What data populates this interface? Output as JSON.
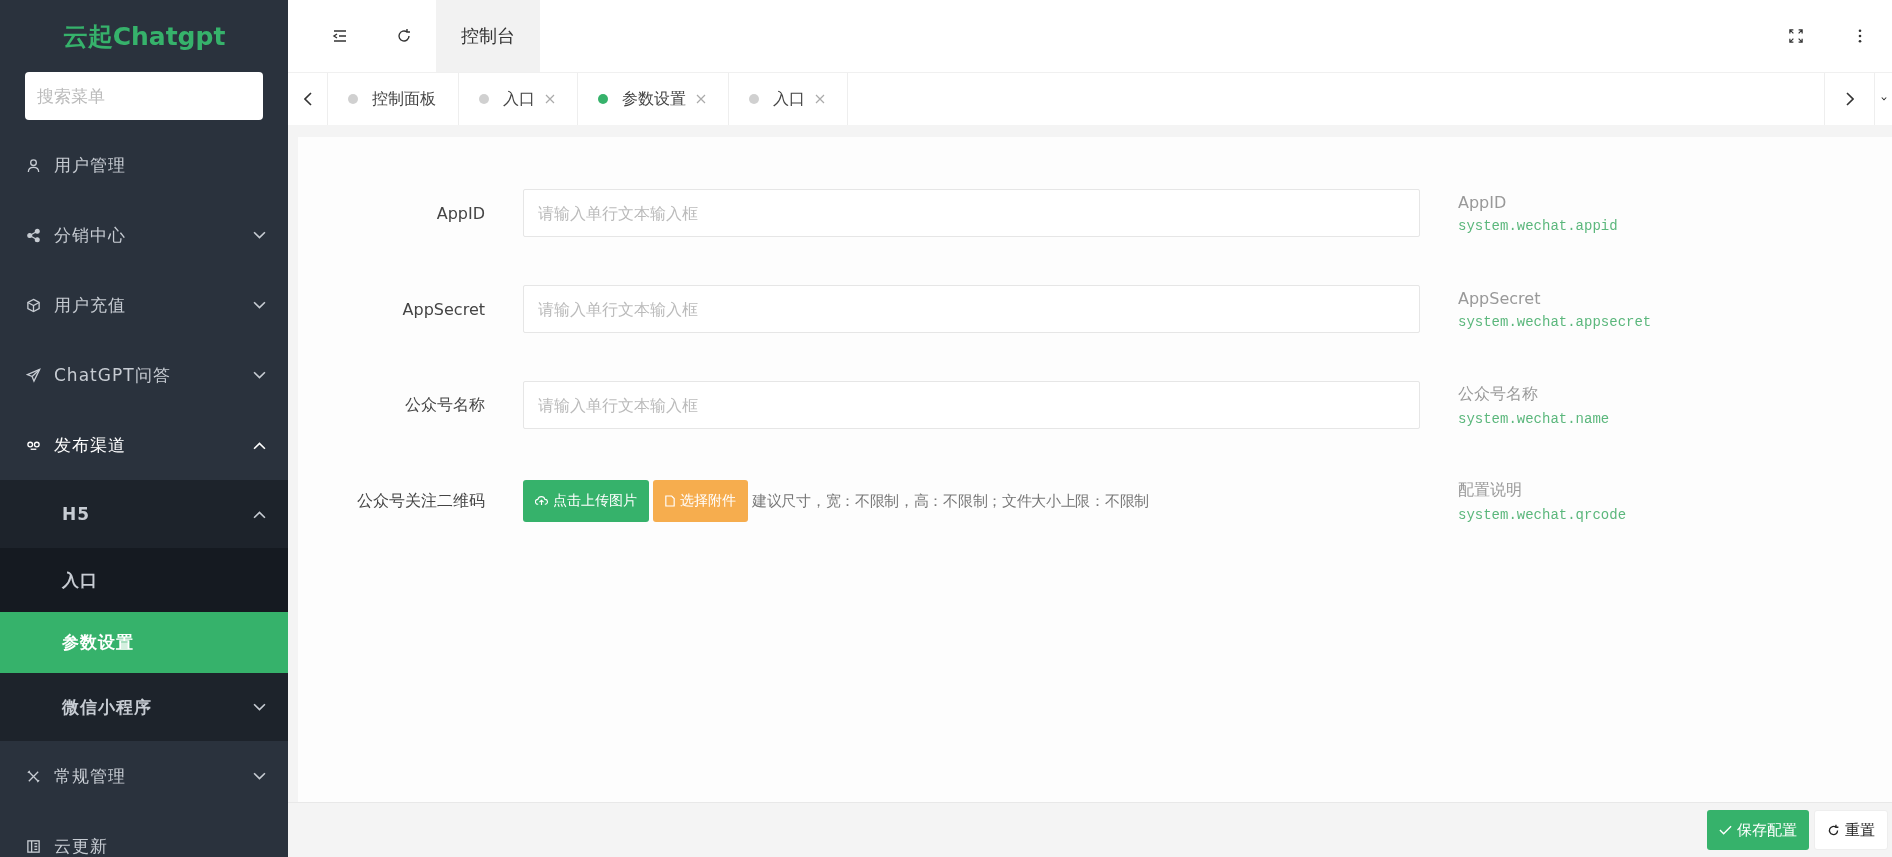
{
  "sidebar": {
    "logo": "云起Chatgpt",
    "search": {
      "placeholder": "搜索菜单"
    },
    "items": [
      {
        "label": "用户管理",
        "selected": false
      },
      {
        "label": "分销中心",
        "selected": false,
        "expanded": false
      },
      {
        "label": "用户充值",
        "selected": false,
        "expanded": false
      },
      {
        "label": "ChatGPT问答",
        "selected": false,
        "expanded": false
      },
      {
        "label": "发布渠道",
        "selected": false,
        "expanded": true,
        "children": [
          {
            "label": "H5",
            "selected": false,
            "expanded": true,
            "children": [
              {
                "label": "入口",
                "selected": false
              },
              {
                "label": "参数设置",
                "selected": true
              }
            ]
          },
          {
            "label": "微信小程序",
            "selected": false,
            "expanded": false
          }
        ]
      },
      {
        "label": "常规管理",
        "selected": false,
        "expanded": false
      },
      {
        "label": "云更新",
        "selected": false
      }
    ]
  },
  "header": {
    "title": "控制台"
  },
  "tabs": [
    {
      "label": "控制面板",
      "selected": false,
      "closable": false
    },
    {
      "label": "入口",
      "selected": false,
      "closable": true
    },
    {
      "label": "参数设置",
      "selected": true,
      "closable": true
    },
    {
      "label": "入口",
      "selected": false,
      "closable": true
    }
  ],
  "form": {
    "rows": [
      {
        "kind": "text",
        "label": "AppID",
        "placeholder": "请输入单行文本输入框",
        "note_title": "AppID",
        "note_key": "system.wechat.appid"
      },
      {
        "kind": "text",
        "label": "AppSecret",
        "placeholder": "请输入单行文本输入框",
        "note_title": "AppSecret",
        "note_key": "system.wechat.appsecret"
      },
      {
        "kind": "text",
        "label": "公众号名称",
        "placeholder": "请输入单行文本输入框",
        "note_title": "公众号名称",
        "note_key": "system.wechat.name"
      },
      {
        "kind": "upload",
        "label": "公众号关注二维码",
        "upload_button": "点击上传图片",
        "attach_button": "选择附件",
        "hint": "建议尺寸，宽：不限制，高：不限制；文件大小上限：不限制",
        "note_title": "配置说明",
        "note_key": "system.wechat.qrcode"
      }
    ]
  },
  "footer": {
    "save_button": "保存配置",
    "reset_button": "重置"
  }
}
